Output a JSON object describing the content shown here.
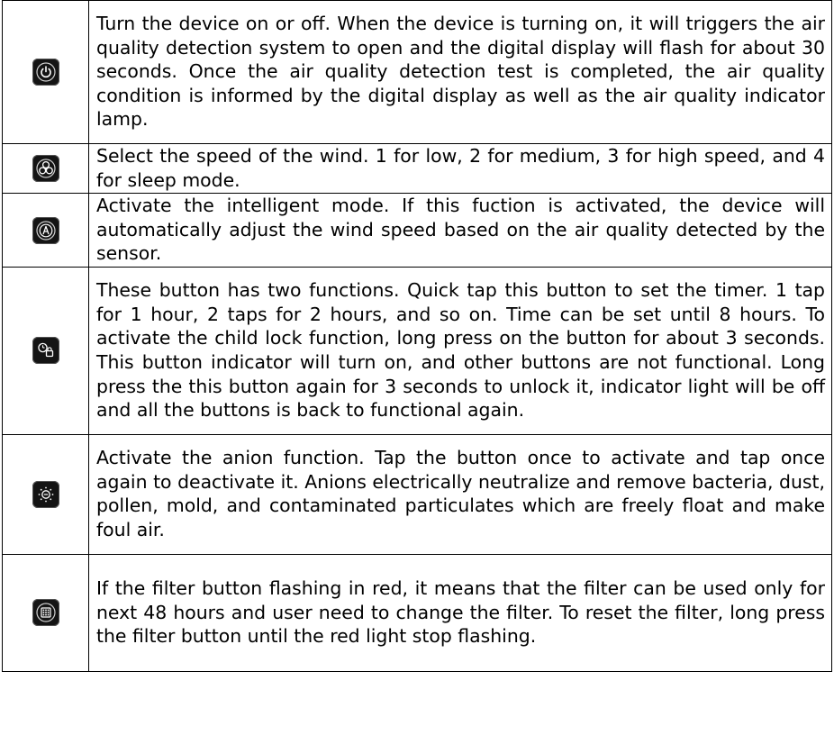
{
  "rows": [
    {
      "icon": "power-icon",
      "text": "Turn the device on or off. When the device is turning on, it will triggers the air quality detection system to open and the digital display will flash for about 30 seconds. Once the air quality detection test is completed, the air quality condition is informed by the digital display as well as the air quality indicator lamp."
    },
    {
      "icon": "fan-icon",
      "text": "Select the speed of the wind. 1 for low, 2 for medium, 3 for high speed, and 4 for sleep mode."
    },
    {
      "icon": "auto-mode-icon",
      "text": "Activate the intelligent mode. If this fuction is activated, the device will automatically adjust the wind speed based on the air quality detected by the sensor."
    },
    {
      "icon": "timer-lock-icon",
      "text": "These button has two functions. Quick tap this button to set the timer. 1 tap for 1 hour, 2 taps for 2 hours, and so on. Time can be set until 8 hours. To activate the child lock function, long press on the button for about 3 seconds. This button indicator will turn on, and other buttons are not functional. Long press the this button again for 3 seconds to unlock it, indicator light will be off and all the buttons is back to functional again."
    },
    {
      "icon": "anion-icon",
      "text": "Activate the anion function. Tap the button once to activate and tap once again to deactivate it. Anions electrically neutralize and remove bacteria, dust, pollen, mold, and contaminated particulates which are freely float and make foul air."
    },
    {
      "icon": "filter-icon",
      "text": "If the filter button flashing in red, it means that the filter can be used only for next 48 hours and user need to change the filter. To reset the filter, long press the filter button until the red light stop flashing."
    }
  ]
}
